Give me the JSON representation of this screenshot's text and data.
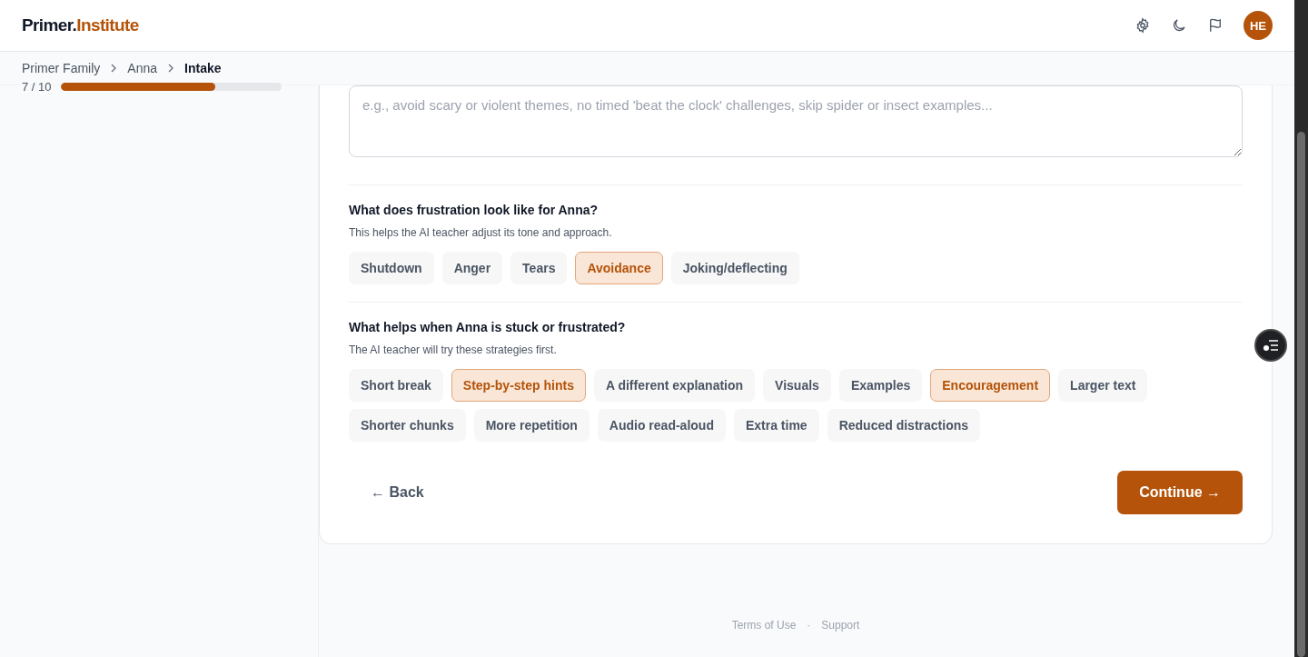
{
  "header": {
    "logo": {
      "primary": "Primer.",
      "accent": "Institute"
    },
    "avatar": "HE"
  },
  "breadcrumb": [
    {
      "label": "Primer Family",
      "current": false
    },
    {
      "label": "Anna",
      "current": false
    },
    {
      "label": "Intake",
      "current": true
    }
  ],
  "progress": {
    "label": "7 / 10",
    "level": 0.7
  },
  "notes_field": {
    "placeholder": "e.g., avoid scary or violent themes, no timed 'beat the clock' challenges, skip spider or insect examples..."
  },
  "questions": [
    {
      "title": "What does frustration look like for Anna?",
      "hint": "This helps the AI teacher adjust its tone and approach.",
      "options": [
        {
          "label": "Shutdown",
          "selected": false
        },
        {
          "label": "Anger",
          "selected": false
        },
        {
          "label": "Tears",
          "selected": false
        },
        {
          "label": "Avoidance",
          "selected": true
        },
        {
          "label": "Joking/deflecting",
          "selected": false
        }
      ]
    },
    {
      "title": "What helps when Anna is stuck or frustrated?",
      "hint": "The AI teacher will try these strategies first.",
      "options": [
        {
          "label": "Short break",
          "selected": false
        },
        {
          "label": "Step-by-step hints",
          "selected": true
        },
        {
          "label": "A different explanation",
          "selected": false
        },
        {
          "label": "Visuals",
          "selected": false
        },
        {
          "label": "Examples",
          "selected": false
        },
        {
          "label": "Encouragement",
          "selected": true
        },
        {
          "label": "Larger text",
          "selected": false
        },
        {
          "label": "Shorter chunks",
          "selected": false
        },
        {
          "label": "More repetition",
          "selected": false
        },
        {
          "label": "Audio read-aloud",
          "selected": false
        },
        {
          "label": "Extra time",
          "selected": false
        },
        {
          "label": "Reduced distractions",
          "selected": false
        }
      ]
    }
  ],
  "buttons": {
    "back": "← Back",
    "continue": "Continue →"
  },
  "footer": {
    "links": [
      "Terms of Use",
      "Support"
    ],
    "separator": "·"
  }
}
